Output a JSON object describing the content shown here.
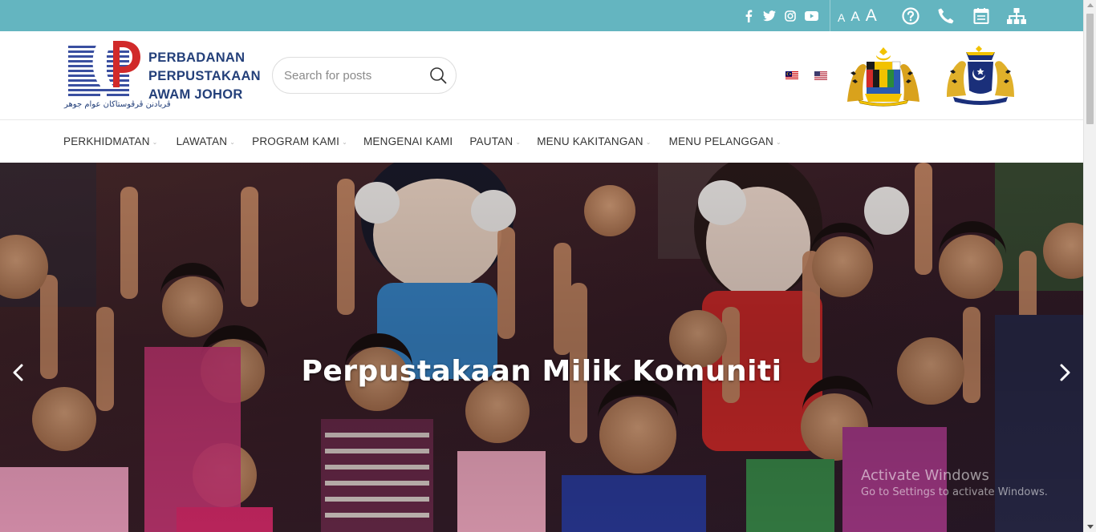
{
  "topbar": {
    "social_icons": [
      "facebook-icon",
      "twitter-icon",
      "instagram-icon",
      "youtube-icon"
    ],
    "font_size_controls": {
      "small": "A",
      "medium": "A",
      "large": "A"
    },
    "tool_icons": [
      "help-icon",
      "phone-icon",
      "calendar-icon",
      "sitemap-icon"
    ],
    "background_color": "#64b5c0"
  },
  "header": {
    "logo_text": {
      "line1": "PERBADANAN",
      "line2": "PERPUSTAKAAN",
      "line3": "AWAM JOHOR"
    },
    "logo_jawi": "ڤربادنن ڤرڤوستاکان عوام جوهر",
    "search": {
      "placeholder": "Search for posts"
    },
    "languages": [
      "flag-malaysia",
      "flag-usa"
    ],
    "crests": [
      "malaysia-coat-of-arms",
      "johor-coat-of-arms"
    ]
  },
  "nav": {
    "items": [
      {
        "label": "PERKHIDMATAN",
        "has_dropdown": true
      },
      {
        "label": "LAWATAN",
        "has_dropdown": true
      },
      {
        "label": "PROGRAM KAMI",
        "has_dropdown": true
      },
      {
        "label": "MENGENAI KAMI",
        "has_dropdown": false
      },
      {
        "label": "PAUTAN",
        "has_dropdown": true
      },
      {
        "label": "MENU KAKITANGAN",
        "has_dropdown": true
      },
      {
        "label": "MENU PELANGGAN",
        "has_dropdown": true
      }
    ]
  },
  "hero": {
    "caption": "Perpustakaan Milik Komuniti",
    "image": "children-cheering-with-mascots-photo"
  },
  "watermark": {
    "title": "Activate Windows",
    "subtitle": "Go to Settings to activate Windows."
  },
  "colors": {
    "brand_blue": "#24407a",
    "brand_red": "#d12a2a",
    "topbar_teal": "#64b5c0"
  }
}
